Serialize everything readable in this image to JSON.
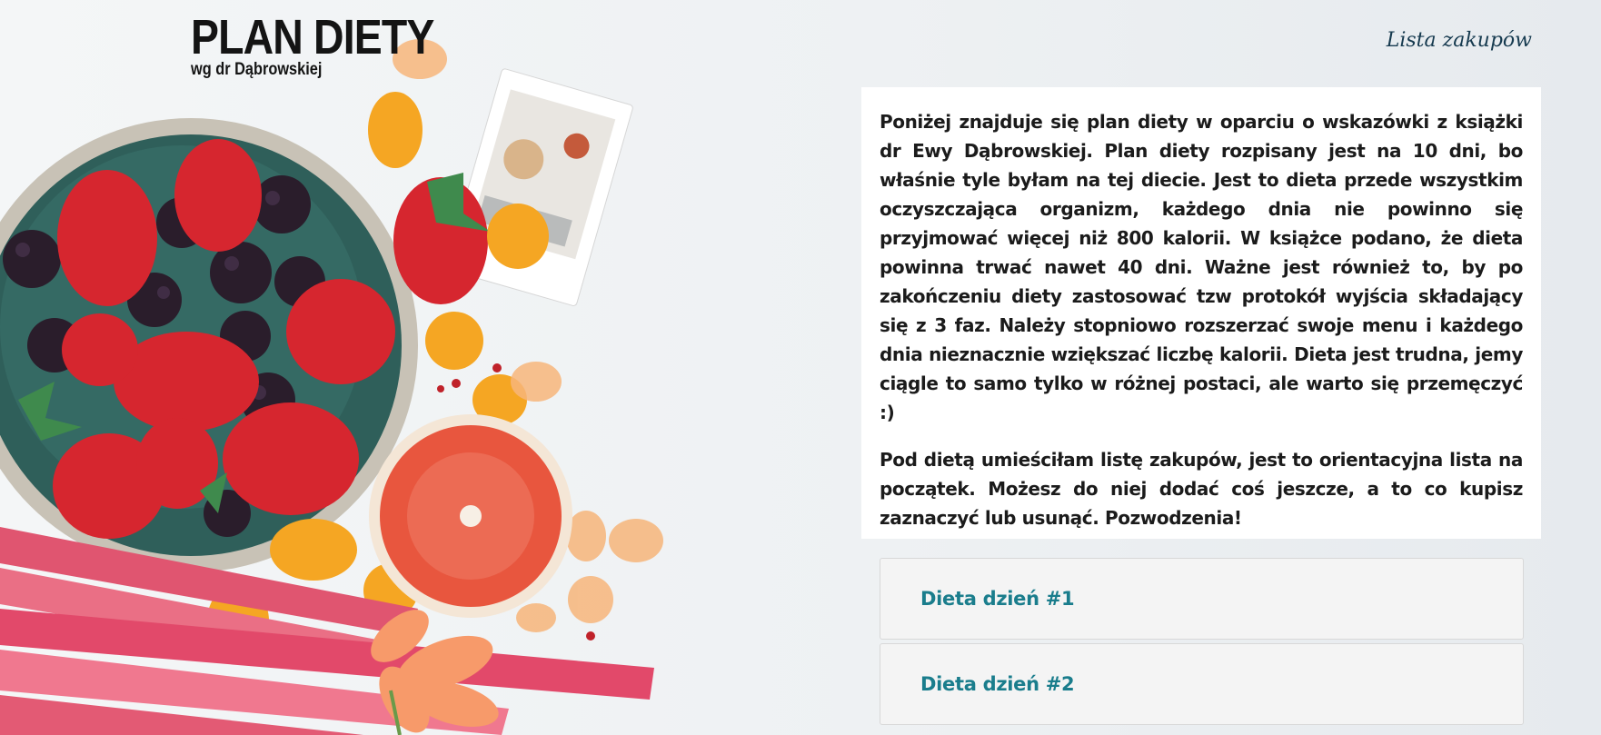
{
  "brand": {
    "title": "PLAN DIETY",
    "subtitle": "wg dr Dąbrowskiej"
  },
  "nav": {
    "shopping_list_link": "Lista zakupów"
  },
  "intro": {
    "paragraph_1": "Poniżej znajduje się plan diety w oparciu o wskazówki z książki dr Ewy Dąbrowskiej. Plan diety rozpisany jest na 10 dni, bo właśnie tyle byłam na tej diecie. Jest to dieta przede wszystkim oczyszczająca organizm, każdego dnia nie powinno się przyjmować więcej niż 800 kalorii. W książce podano, że dieta powinna trwać nawet 40 dni. Ważne jest również to, by po zakończeniu diety zastosować tzw protokół wyjścia składający się z 3 faz. Należy stopniowo rozszerzać swoje menu i każdego dnia nieznacznie wziększać liczbę kalorii. Dieta jest trudna, jemy ciągle to samo tylko w różnej postaci, ale warto się przemęczyć :)",
    "paragraph_2": "Pod dietą umieściłam listę zakupów, jest to orientacyjna lista na początek. Możesz do niej dodać coś jeszcze, a to co kupisz zaznaczyć lub usunąć. Pozwodzenia!"
  },
  "days": [
    {
      "label": "Dieta dzień #1"
    },
    {
      "label": "Dieta dzień #2"
    }
  ],
  "colors": {
    "accent": "#1a7d8c",
    "nav_link": "#163a4f",
    "text": "#1b1b1b"
  },
  "icons": {
    "hero": "fruit-bowl-image"
  }
}
